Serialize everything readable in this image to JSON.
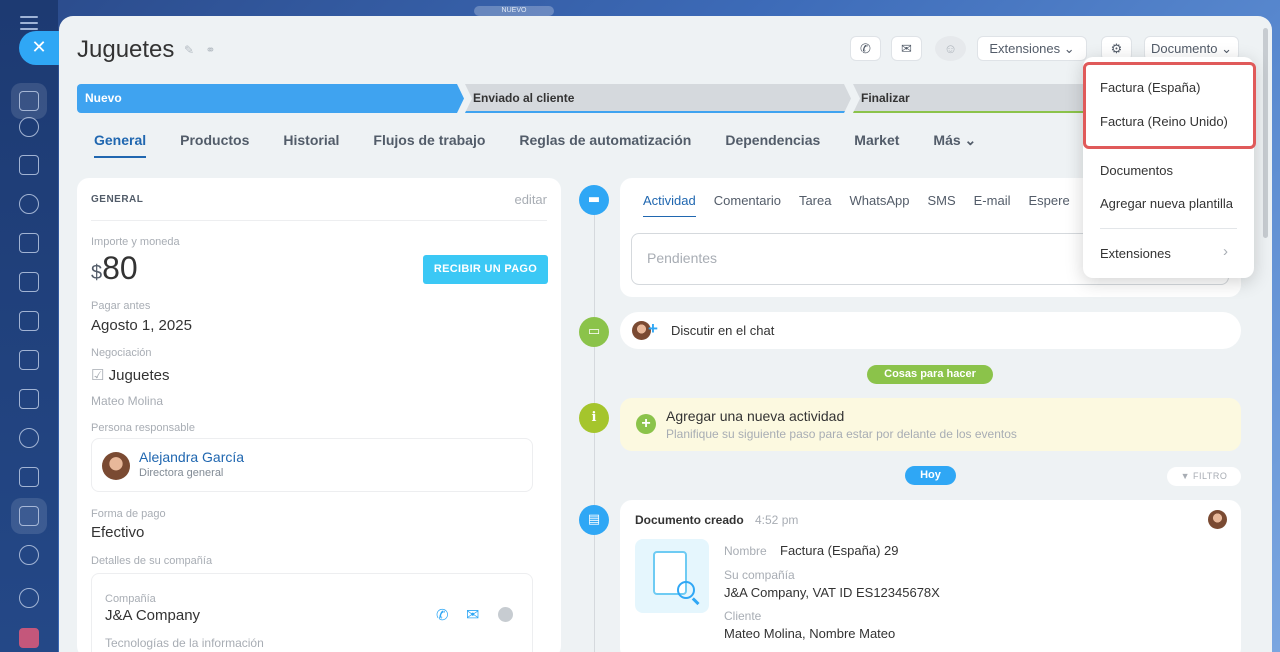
{
  "top_pill": "NUEVO",
  "title": "Juguetes",
  "header": {
    "extensions_label": "Extensiones",
    "document_label": "Documento"
  },
  "stages": [
    "Nuevo",
    "Enviado al cliente",
    "Finalizar"
  ],
  "tabs": [
    {
      "label": "General",
      "active": true
    },
    {
      "label": "Productos"
    },
    {
      "label": "Historial"
    },
    {
      "label": "Flujos de trabajo"
    },
    {
      "label": "Reglas de automatización"
    },
    {
      "label": "Dependencias"
    },
    {
      "label": "Market"
    },
    {
      "label": "Más"
    }
  ],
  "general": {
    "heading": "GENERAL",
    "edit": "editar",
    "amount_label": "Importe y moneda",
    "currency": "$",
    "amount": "80",
    "pay_button": "RECIBIR UN PAGO",
    "pay_before_label": "Pagar antes",
    "pay_before": "Agosto 1, 2025",
    "deal_label": "Negociación",
    "deal": "Juguetes",
    "deal_contact": "Mateo Molina",
    "responsible_label": "Persona responsable",
    "responsible_name": "Alejandra García",
    "responsible_role": "Directora general",
    "payment_label": "Forma de pago",
    "payment": "Efectivo",
    "company_details_label": "Detalles de su compañía",
    "company_label": "Compañía",
    "company": "J&A Company",
    "industry": "Tecnologías de la información"
  },
  "activity": {
    "tabs": [
      "Actividad",
      "Comentario",
      "Tarea",
      "WhatsApp",
      "SMS",
      "E-mail",
      "Espere"
    ],
    "placeholder": "Pendientes",
    "chat": "Discutir en el chat",
    "todo_badge": "Cosas para hacer",
    "new_activity_title": "Agregar una nueva actividad",
    "new_activity_sub": "Planifique su siguiente paso para estar por delante de los eventos",
    "today_badge": "Hoy",
    "filter": "FILTRO",
    "doc_title": "Documento creado",
    "doc_time": "4:52 pm",
    "doc_name_label": "Nombre",
    "doc_name": "Factura (España) 29",
    "doc_company_label": "Su compañía",
    "doc_company": "J&A Company, VAT ID ES12345678X",
    "doc_client_label": "Cliente",
    "doc_client": "Mateo Molina, Nombre Mateo"
  },
  "dropdown": {
    "items": [
      "Factura (España)",
      "Factura (Reino Unido)",
      "Documentos",
      "Agregar nueva plantilla",
      "Extensiones"
    ]
  },
  "colors": {
    "accent": "#2fa7f5",
    "stage_active": "#3fa3f0",
    "success": "#8bc34a",
    "highlight": "#e05a5a"
  }
}
